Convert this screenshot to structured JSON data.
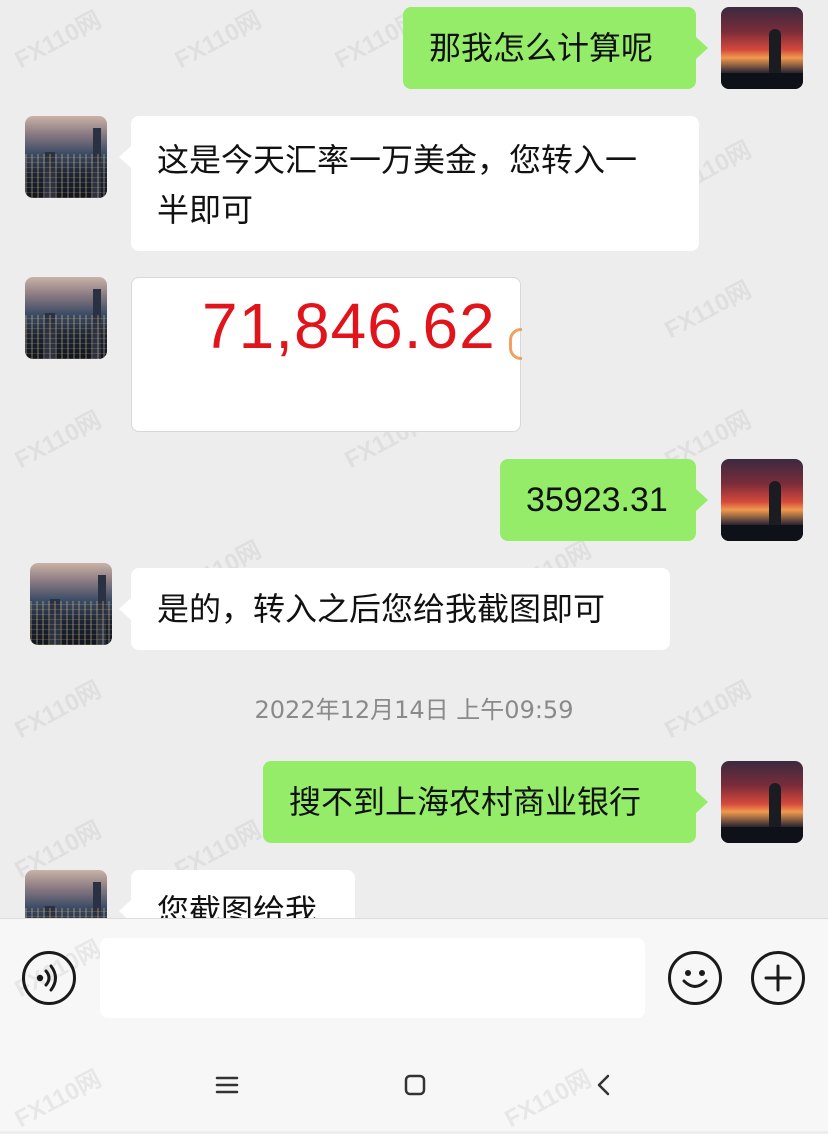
{
  "messages": [
    {
      "side": "out",
      "type": "text",
      "text": "那我怎么计算呢"
    },
    {
      "side": "in",
      "type": "text",
      "line1": "这是今天汇率一万美金，您转入一",
      "line2": "半即可"
    },
    {
      "side": "in",
      "type": "image",
      "amount": "71,846.62"
    },
    {
      "side": "out",
      "type": "text",
      "text": "35923.31"
    },
    {
      "side": "in",
      "type": "text",
      "text": "是的，转入之后您给我截图即可"
    },
    {
      "side": "out",
      "type": "text",
      "text": "搜不到上海农村商业银行"
    },
    {
      "side": "in",
      "type": "text",
      "text": "您截图给我"
    }
  ],
  "timestamp": "2022年12月14日 上午09:59",
  "watermark": "FX110网",
  "input_bar": {
    "voice_icon": "voice-icon",
    "emoji_icon": "emoji-icon",
    "add_icon": "plus-icon"
  },
  "nav_bar": {
    "menu_icon": "menu-icon",
    "home_icon": "home-icon",
    "back_icon": "back-icon"
  },
  "colors": {
    "background": "#ededed",
    "outgoing_bubble": "#95ec69",
    "incoming_bubble": "#ffffff",
    "amount_text": "#e0141a"
  }
}
